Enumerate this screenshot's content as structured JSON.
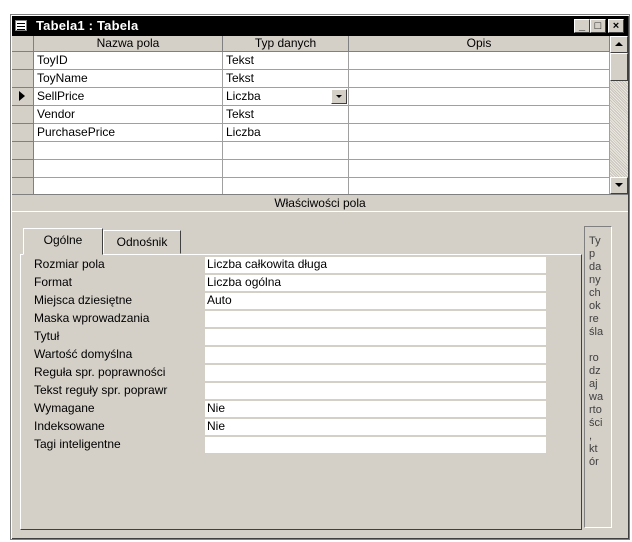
{
  "window": {
    "title": "Tabela1 : Tabela",
    "minimize_label": "_",
    "restore_label": "□",
    "close_label": "×"
  },
  "grid": {
    "headers": [
      "Nazwa pola",
      "Typ danych",
      "Opis"
    ],
    "rows": [
      {
        "name": "ToyID",
        "type": "Tekst",
        "desc": ""
      },
      {
        "name": "ToyName",
        "type": "Tekst",
        "desc": ""
      },
      {
        "name": "SellPrice",
        "type": "Liczba",
        "desc": ""
      },
      {
        "name": "Vendor",
        "type": "Tekst",
        "desc": ""
      },
      {
        "name": "PurchasePrice",
        "type": "Liczba",
        "desc": ""
      },
      {
        "name": "",
        "type": "",
        "desc": ""
      },
      {
        "name": "",
        "type": "",
        "desc": ""
      },
      {
        "name": "",
        "type": "",
        "desc": ""
      }
    ],
    "current_row": 2
  },
  "properties": {
    "band_label": "Właściwości pola",
    "tabs": [
      "Ogólne",
      "Odnośnik"
    ],
    "active_tab": 0,
    "fields": [
      {
        "label": "Rozmiar pola",
        "value": "Liczba całkowita długa"
      },
      {
        "label": "Format",
        "value": "Liczba ogólna"
      },
      {
        "label": "Miejsca dziesiętne",
        "value": "Auto"
      },
      {
        "label": "Maska wprowadzania",
        "value": ""
      },
      {
        "label": "Tytuł",
        "value": ""
      },
      {
        "label": "Wartość domyślna",
        "value": ""
      },
      {
        "label": "Reguła spr. poprawności",
        "value": ""
      },
      {
        "label": "Tekst reguły spr. poprawr",
        "value": ""
      },
      {
        "label": "Wymagane",
        "value": "Nie"
      },
      {
        "label": "Indeksowane",
        "value": "Nie"
      },
      {
        "label": "Tagi inteligentne",
        "value": ""
      }
    ],
    "help_text": "Ty\np\nda\nny\nch\nok\nre\nśla\n\nro\ndz\naj\nwa\nrto\nści\n,\nkt\nór"
  }
}
